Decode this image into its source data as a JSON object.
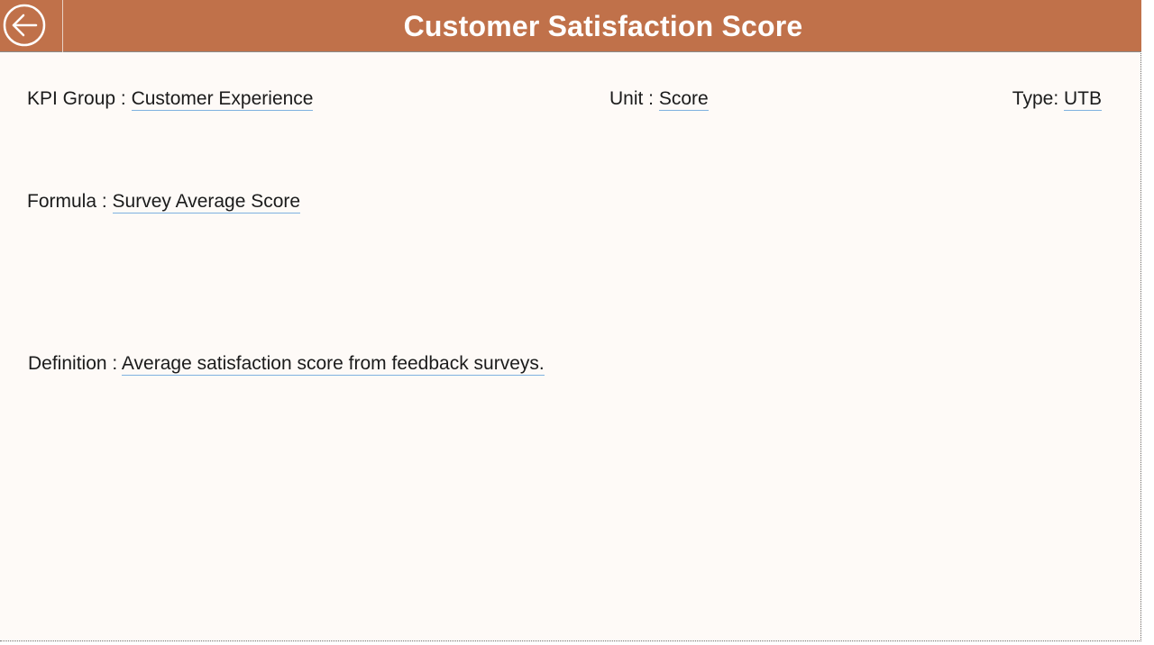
{
  "header": {
    "title": "Customer Satisfaction Score",
    "back_icon": "arrow-left-circle-icon",
    "background_color": "#c0714a"
  },
  "fields": {
    "kpi_group": {
      "label": "KPI Group : ",
      "value": "Customer Experience"
    },
    "unit": {
      "label": "Unit : ",
      "value": "Score"
    },
    "type": {
      "label": "Type: ",
      "value": "UTB"
    },
    "formula": {
      "label": "Formula : ",
      "value": "Survey Average Score"
    },
    "definition": {
      "label": "Definition : ",
      "value": "Average satisfaction score from feedback surveys."
    }
  }
}
